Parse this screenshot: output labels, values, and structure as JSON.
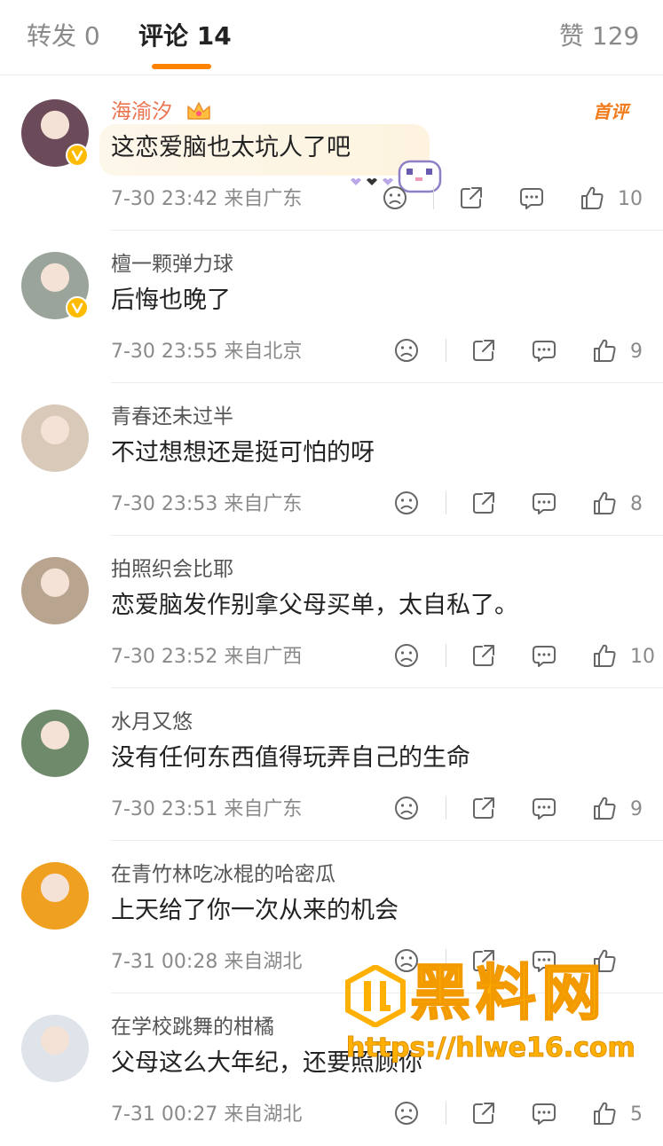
{
  "tabs": [
    {
      "label": "转发 0"
    },
    {
      "label": "评论 14"
    },
    {
      "label": "赞 129"
    }
  ],
  "colors": {
    "accent": "#ff8200",
    "vip_name": "#eb7350",
    "muted": "#8a8a8a",
    "watermark": "#ffb000"
  },
  "comments": [
    {
      "name": "海渝汐",
      "text": "这恋爱脑也太坑人了吧",
      "time": "7-30 23:42",
      "location": "来自广东",
      "likes": "10",
      "badge": "首评",
      "verified": true,
      "avatar_color": "#6b4a5a"
    },
    {
      "name": "檀一颗弹力球",
      "text": "后悔也晚了",
      "time": "7-30 23:55",
      "location": "来自北京",
      "likes": "9",
      "verified": true,
      "avatar_color": "#9aa49a"
    },
    {
      "name": "青春还未过半",
      "text": "不过想想还是挺可怕的呀",
      "time": "7-30 23:53",
      "location": "来自广东",
      "likes": "8",
      "verified": false,
      "avatar_color": "#d9c9b8"
    },
    {
      "name": "拍照织会比耶",
      "text": "恋爱脑发作别拿父母买单，太自私了。",
      "time": "7-30 23:52",
      "location": "来自广西",
      "likes": "10",
      "verified": false,
      "avatar_color": "#b8a48f"
    },
    {
      "name": "水月又悠",
      "text": "没有任何东西值得玩弄自己的生命",
      "time": "7-30 23:51",
      "location": "来自广东",
      "likes": "9",
      "verified": false,
      "avatar_color": "#6e8a6a"
    },
    {
      "name": "在青竹林吃冰棍的哈密瓜",
      "text": "上天给了你一次从来的机会",
      "time": "7-31 00:28",
      "location": "来自湖北",
      "likes": "",
      "verified": false,
      "avatar_color": "#f0a020"
    },
    {
      "name": "在学校跳舞的柑橘",
      "text": "父母这么大年纪，还要照顾你",
      "time": "7-31 00:27",
      "location": "来自湖北",
      "likes": "5",
      "verified": false,
      "avatar_color": "#dfe3ea"
    }
  ],
  "watermark": {
    "title": "黑料网",
    "url": "https://hlwe16.com"
  }
}
